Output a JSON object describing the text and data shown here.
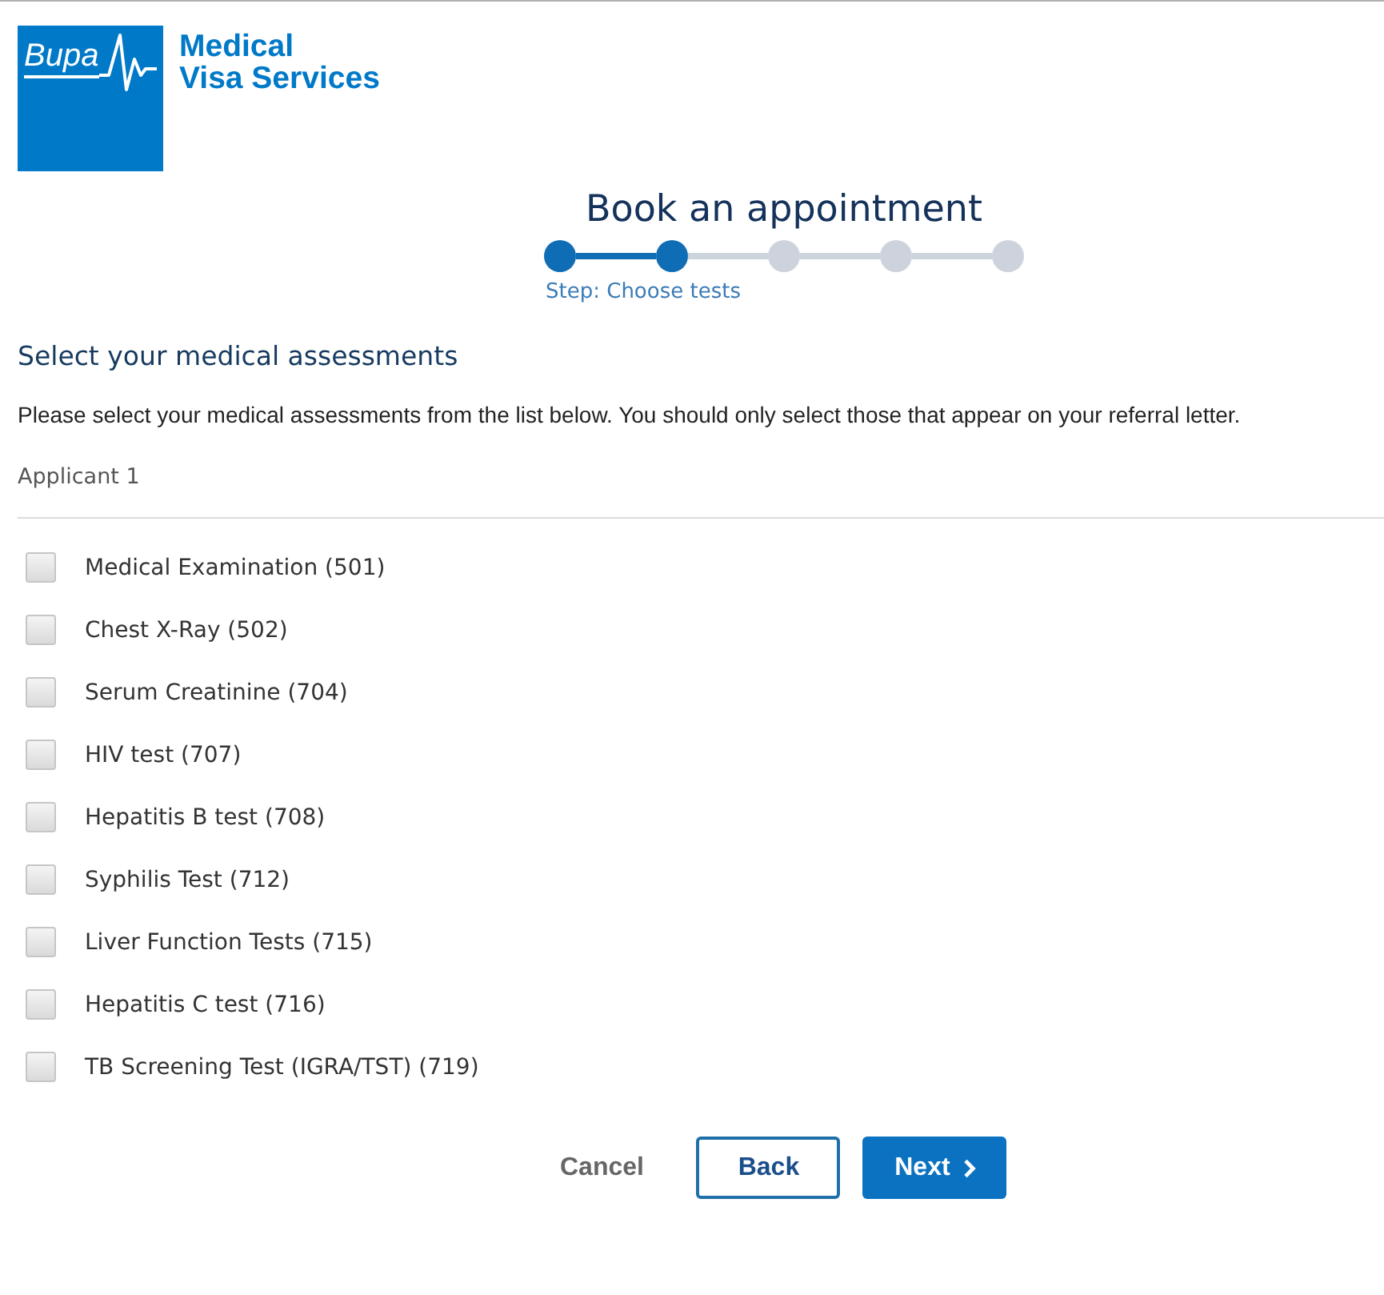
{
  "logo": {
    "wordmark": "Bupa",
    "brand_lines": [
      "Medical",
      "Visa Services"
    ]
  },
  "title": "Book an appointment",
  "stepper": {
    "steps": [
      {
        "completed": true
      },
      {
        "completed": true
      },
      {
        "completed": false
      },
      {
        "completed": false
      },
      {
        "completed": false
      }
    ],
    "caption": "Step: Choose tests"
  },
  "section": {
    "heading": "Select your medical assessments",
    "intro": "Please select your medical assessments from the list below. You should only select those that appear on your referral letter.",
    "applicant": "Applicant 1"
  },
  "assessments": [
    {
      "label": "Medical Examination (501)",
      "checked": false
    },
    {
      "label": "Chest X-Ray (502)",
      "checked": false
    },
    {
      "label": "Serum Creatinine (704)",
      "checked": false
    },
    {
      "label": "HIV test (707)",
      "checked": false
    },
    {
      "label": "Hepatitis B test (708)",
      "checked": false
    },
    {
      "label": "Syphilis Test (712)",
      "checked": false
    },
    {
      "label": "Liver Function Tests (715)",
      "checked": false
    },
    {
      "label": "Hepatitis C test (716)",
      "checked": false
    },
    {
      "label": "TB Screening Test (IGRA/TST) (719)",
      "checked": false
    }
  ],
  "actions": [
    {
      "label": "Cancel",
      "kind": "link"
    },
    {
      "label": "Back",
      "kind": "secondary"
    },
    {
      "label": "Next",
      "kind": "primary"
    }
  ]
}
